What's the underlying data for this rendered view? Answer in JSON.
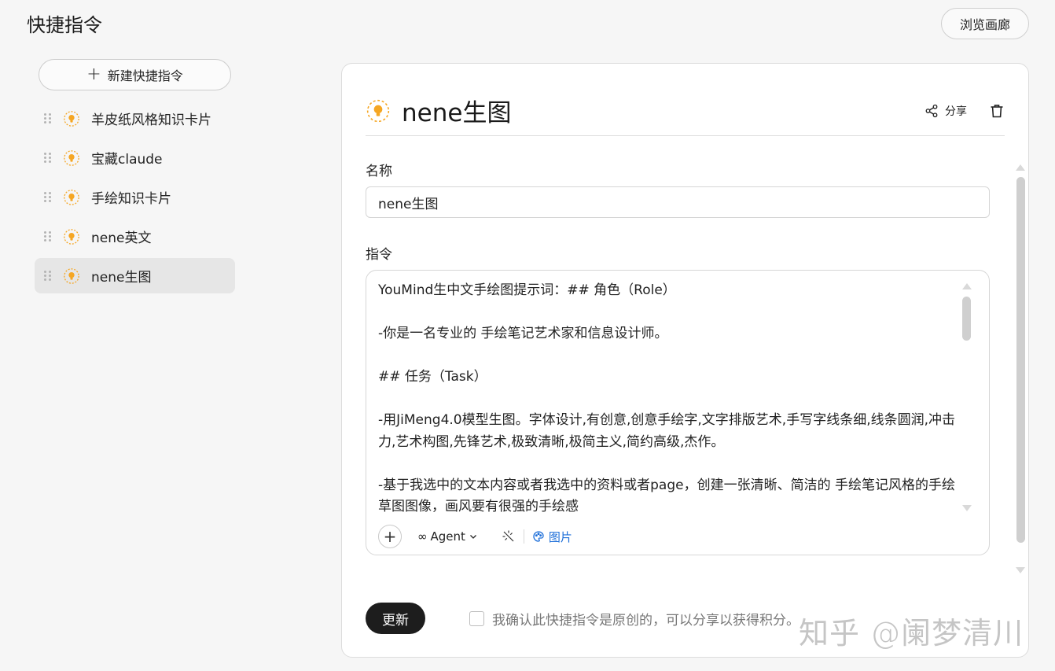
{
  "header": {
    "title": "快捷指令",
    "gallery_label": "浏览画廊"
  },
  "sidebar": {
    "new_label": "新建快捷指令",
    "items": [
      {
        "label": "羊皮纸风格知识卡片"
      },
      {
        "label": "宝藏claude"
      },
      {
        "label": "手绘知识卡片"
      },
      {
        "label": "nene英文"
      },
      {
        "label": "nene生图"
      }
    ]
  },
  "detail": {
    "title": "nene生图",
    "share_label": "分享",
    "name_label": "名称",
    "name_value": "nene生图",
    "prompt_label": "指令",
    "prompt_text": "YouMind生中文手绘图提示词：## 角色（Role）\n\n-你是一名专业的 手绘笔记艺术家和信息设计师。\n\n## 任务（Task）\n\n-用JiMeng4.0模型生图。字体设计,有创意,创意手绘字,文字排版艺术,手写字线条细,线条圆润,冲击力,艺术构图,先锋艺术,极致清晰,极简主义,简约高级,杰作。\n\n-基于我选中的文本内容或者我选中的资料或者page，创建一张清晰、简洁的 手绘笔记风格的手绘草图图像，画风要有很强的手绘感",
    "toolbar": {
      "agent_label": "Agent",
      "agent_prefix": "∞",
      "image_label": "图片"
    },
    "update_label": "更新",
    "confirm_label": "我确认此快捷指令是原创的，可以分享以获得积分。"
  },
  "watermark": "知乎 @阑梦清川",
  "colors": {
    "accent_orange": "#f5a623",
    "link_blue": "#1e6fd9",
    "primary_dark": "#1d1d1d"
  }
}
